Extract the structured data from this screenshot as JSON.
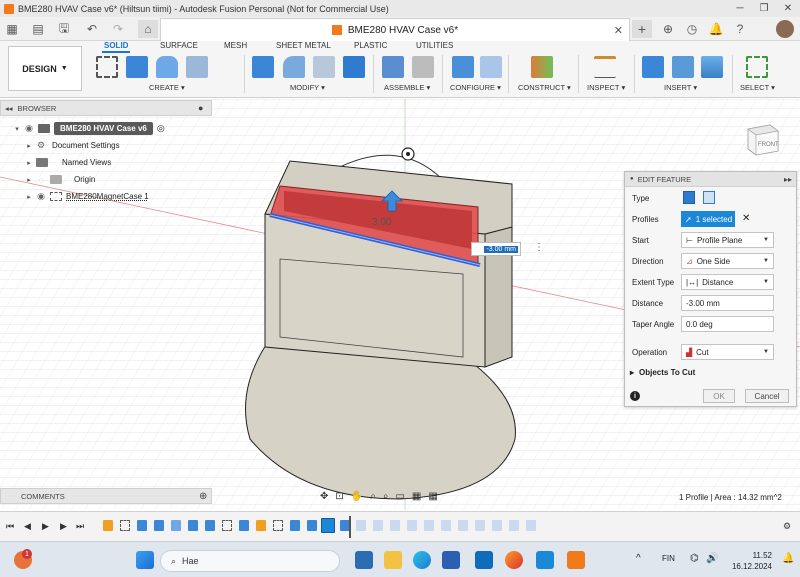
{
  "window": {
    "title": "BME280 HVAV Case v6* (Hiltsun tiimi) - Autodesk Fusion Personal (Not for Commercial Use)",
    "doc_tab": "BME280 HVAV Case v6*"
  },
  "ribbon": {
    "workspace": "DESIGN",
    "tabs": [
      "SOLID",
      "SURFACE",
      "MESH",
      "SHEET METAL",
      "PLASTIC",
      "UTILITIES"
    ],
    "active_tab": "SOLID",
    "groups": [
      "CREATE",
      "MODIFY",
      "ASSEMBLE",
      "CONFIGURE",
      "CONSTRUCT",
      "INSPECT",
      "INSERT",
      "SELECT"
    ]
  },
  "browser": {
    "header": "BROWSER",
    "items": [
      {
        "label": "BME280 HVAV Case v6",
        "level": 0
      },
      {
        "label": "Document Settings",
        "level": 1
      },
      {
        "label": "Named Views",
        "level": 1
      },
      {
        "label": "Origin",
        "level": 1
      },
      {
        "label": "BME280MagnetCase 1",
        "level": 1
      }
    ]
  },
  "viewcube": {
    "face": "FRONT"
  },
  "dimension": {
    "value": "-3.00 mm",
    "ghost": "3.00"
  },
  "edit_feature": {
    "header": "EDIT FEATURE",
    "labels": {
      "type": "Type",
      "profiles": "Profiles",
      "start": "Start",
      "direction": "Direction",
      "extent_type": "Extent Type",
      "distance": "Distance",
      "taper": "Taper Angle",
      "operation": "Operation",
      "objects_to_cut": "Objects To Cut"
    },
    "values": {
      "profiles": "1 selected",
      "start": "Profile Plane",
      "direction": "One Side",
      "extent_type": "Distance",
      "distance": "-3.00 mm",
      "taper": "0.0 deg",
      "operation": "Cut"
    },
    "ok": "OK",
    "cancel": "Cancel"
  },
  "comments": {
    "label": "COMMENTS"
  },
  "status": {
    "text": "1 Profile | Area : 14.32 mm^2"
  },
  "taskbar": {
    "search_placeholder": "Hae",
    "lang": "FIN",
    "time": "11.52",
    "date": "16.12.2024",
    "notification_badge": "1"
  },
  "colors": {
    "accent": "#1a73d9",
    "selection": "#1b87d6",
    "cut_red": "#e05050",
    "model_face": "#d9d4c8"
  }
}
